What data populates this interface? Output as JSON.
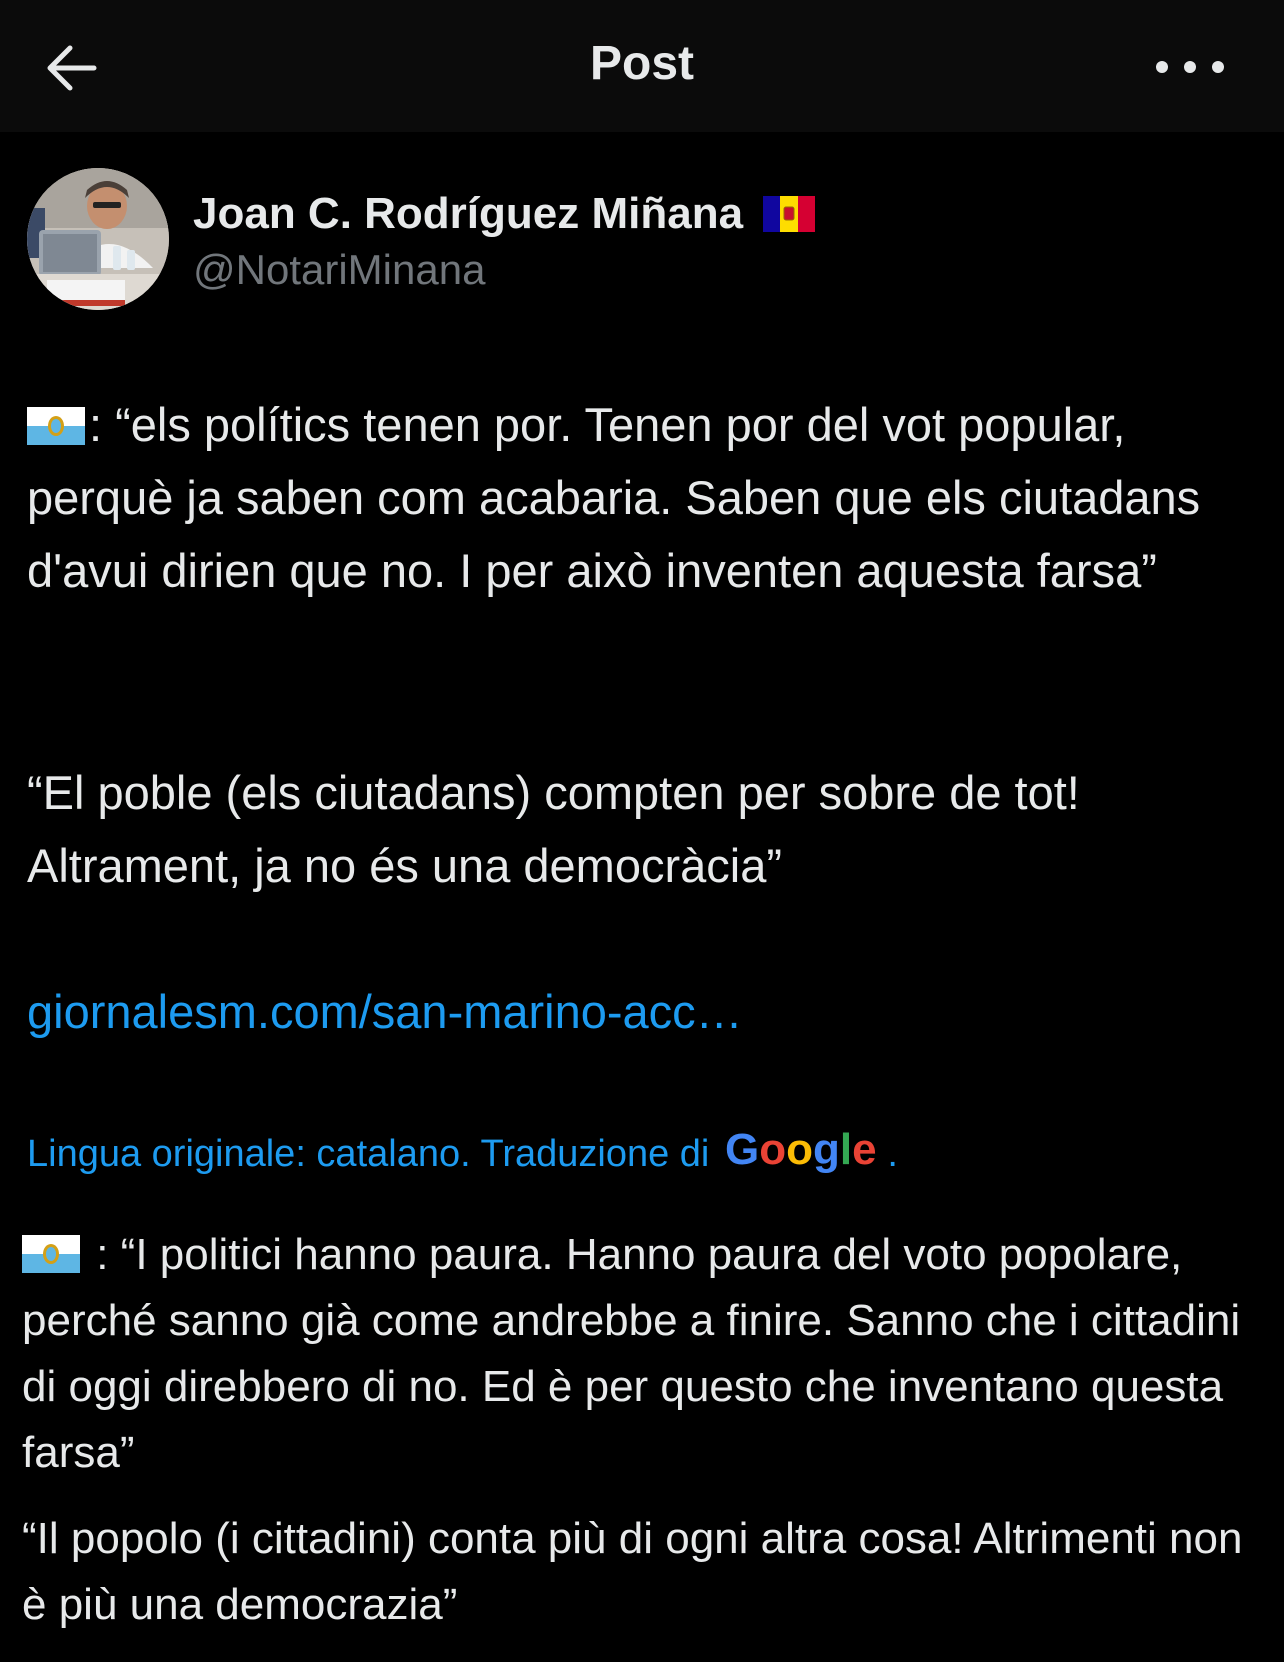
{
  "header": {
    "title": "Post",
    "back_icon": "arrow-left-icon",
    "more_icon": "more-horizontal-icon"
  },
  "post": {
    "author": {
      "name": "Joan C. Rodríguez Miñana",
      "handle": "@NotariMinana",
      "name_flag": "andorra-flag-icon"
    },
    "paragraphs": [
      ": “els polítics tenen por. Tenen por del vot popular, perquè ja saben com acabaria. Saben que els ciutadans d'avui dirien que no. I per això inventen aquesta farsa”",
      "“El poble (els ciutadans) compten per sobre de tot! Altrament, ja no és una democràcia”"
    ],
    "link_text": "giornalesm.com/san-marino-acc…",
    "translation": {
      "note": "Lingua originale: catalano. Traduzione di",
      "provider": "Google",
      "paragraphs": [
        " : “I politici hanno paura. Hanno paura del voto popolare, perché sanno già come andrebbe a finire. Sanno che i cittadini di oggi direbbero di no. Ed è per questo che inventano questa farsa”",
        "“Il popolo (i cittadini) conta più di ogni altra cosa! Altrimenti non è più una democrazia”"
      ]
    }
  },
  "colors": {
    "background": "#000000",
    "topbar": "#0b0b0b",
    "text": "#e7e9ea",
    "muted": "#71767b",
    "link": "#1d9bf0"
  }
}
